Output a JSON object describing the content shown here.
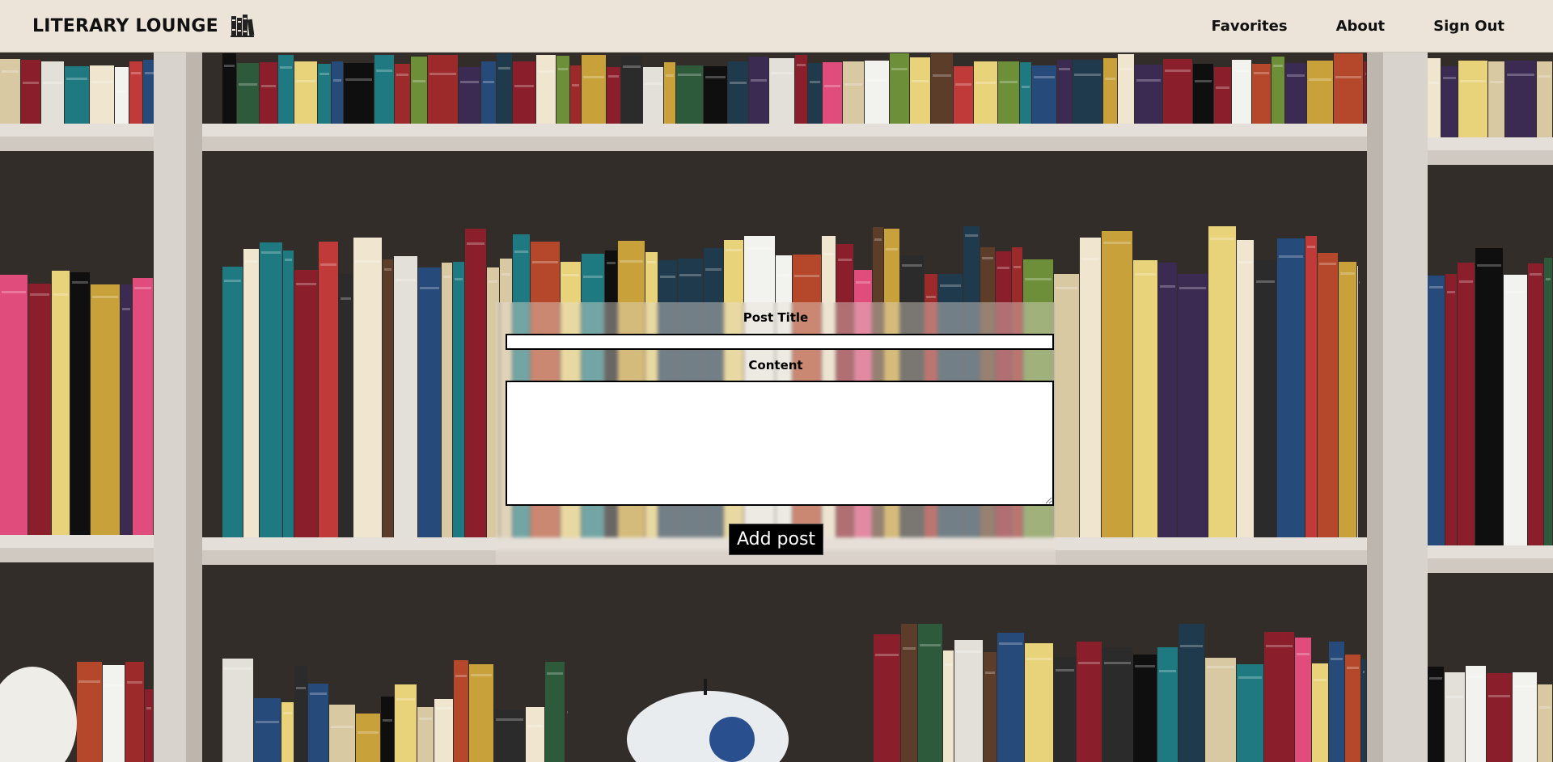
{
  "brand": {
    "title": "LITERARY LOUNGE",
    "icon": "books-icon"
  },
  "nav": {
    "favorites": "Favorites",
    "about": "About",
    "sign_out": "Sign Out"
  },
  "form": {
    "title_label": "Post Title",
    "title_value": "",
    "content_label": "Content",
    "content_value": "",
    "submit_label": "Add post"
  },
  "background": {
    "description_icon": "bookshelf-image"
  }
}
